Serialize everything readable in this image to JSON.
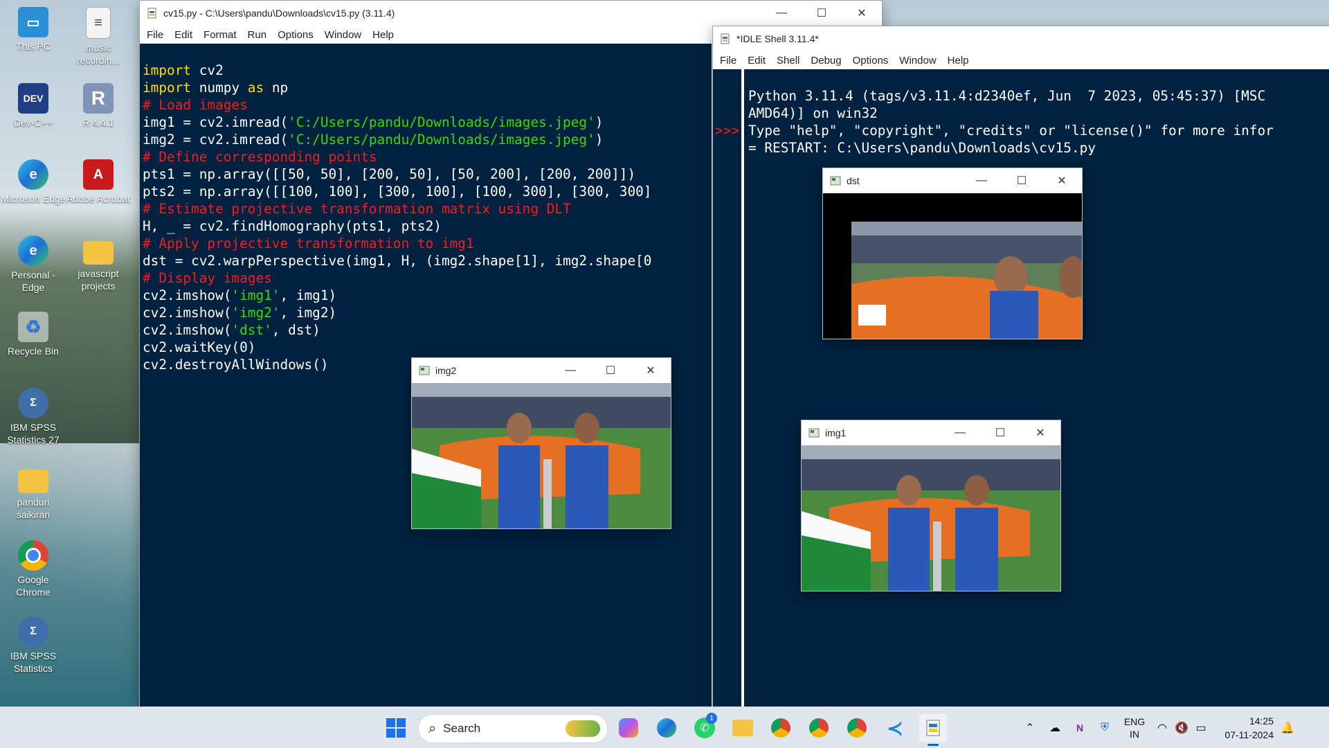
{
  "desktop": {
    "icons": [
      {
        "label": "This PC"
      },
      {
        "label": "music recordin..."
      },
      {
        "label": "Dev-C++"
      },
      {
        "label": "R 4.4.1"
      },
      {
        "label": "Microsoft Edge"
      },
      {
        "label": "Adobe Acrobat"
      },
      {
        "label": "Personal - Edge"
      },
      {
        "label": "javascript projects"
      },
      {
        "label": "Recycle Bin"
      },
      {
        "label": "IBM SPSS Statistics 27"
      },
      {
        "label": "panduri saikiran"
      },
      {
        "label": "Google Chrome"
      },
      {
        "label": "IBM SPSS Statistics"
      }
    ]
  },
  "editor": {
    "title": "cv15.py - C:\\Users\\pandu\\Downloads\\cv15.py (3.11.4)",
    "menu": [
      "File",
      "Edit",
      "Format",
      "Run",
      "Options",
      "Window",
      "Help"
    ],
    "code": {
      "l1a": "import",
      "l1b": " cv2",
      "l2a": "import",
      "l2b": " numpy ",
      "l2c": "as",
      "l2d": " np",
      "l3": "# Load images",
      "l4a": "img1 = cv2.imread(",
      "l4b": "'C:/Users/pandu/Downloads/images.jpeg'",
      "l4c": ")",
      "l5a": "img2 = cv2.imread(",
      "l5b": "'C:/Users/pandu/Downloads/images.jpeg'",
      "l5c": ")",
      "l6": "# Define corresponding points",
      "l7": "pts1 = np.array([[50, 50], [200, 50], [50, 200], [200, 200]])",
      "l8": "pts2 = np.array([[100, 100], [300, 100], [100, 300], [300, 300]",
      "l9": "# Estimate projective transformation matrix using DLT",
      "l10": "H, _ = cv2.findHomography(pts1, pts2)",
      "l11": "# Apply projective transformation to img1",
      "l12": "dst = cv2.warpPerspective(img1, H, (img2.shape[1], img2.shape[0",
      "l13": "# Display images",
      "l14a": "cv2.imshow(",
      "l14b": "'img1'",
      "l14c": ", img1)",
      "l15a": "cv2.imshow(",
      "l15b": "'img2'",
      "l15c": ", img2)",
      "l16a": "cv2.imshow(",
      "l16b": "'dst'",
      "l16c": ", dst)",
      "l17": "cv2.waitKey(0)",
      "l18": "cv2.destroyAllWindows()"
    }
  },
  "shell": {
    "title": "*IDLE Shell 3.11.4*",
    "menu": [
      "File",
      "Edit",
      "Shell",
      "Debug",
      "Options",
      "Window",
      "Help"
    ],
    "prompt": ">>>",
    "lines": [
      "Python 3.11.4 (tags/v3.11.4:d2340ef, Jun  7 2023, 05:45:37) [MSC",
      "AMD64)] on win32",
      "Type \"help\", \"copyright\", \"credits\" or \"license()\" for more infor",
      "",
      "= RESTART: C:\\Users\\pandu\\Downloads\\cv15.py"
    ]
  },
  "image_windows": {
    "dst": {
      "title": "dst"
    },
    "img2": {
      "title": "img2"
    },
    "img1": {
      "title": "img1"
    }
  },
  "taskbar": {
    "search_placeholder": "Search",
    "whatsapp_badge": "1",
    "lang_line1": "ENG",
    "lang_line2": "IN",
    "time": "14:25",
    "date": "07-11-2024"
  }
}
